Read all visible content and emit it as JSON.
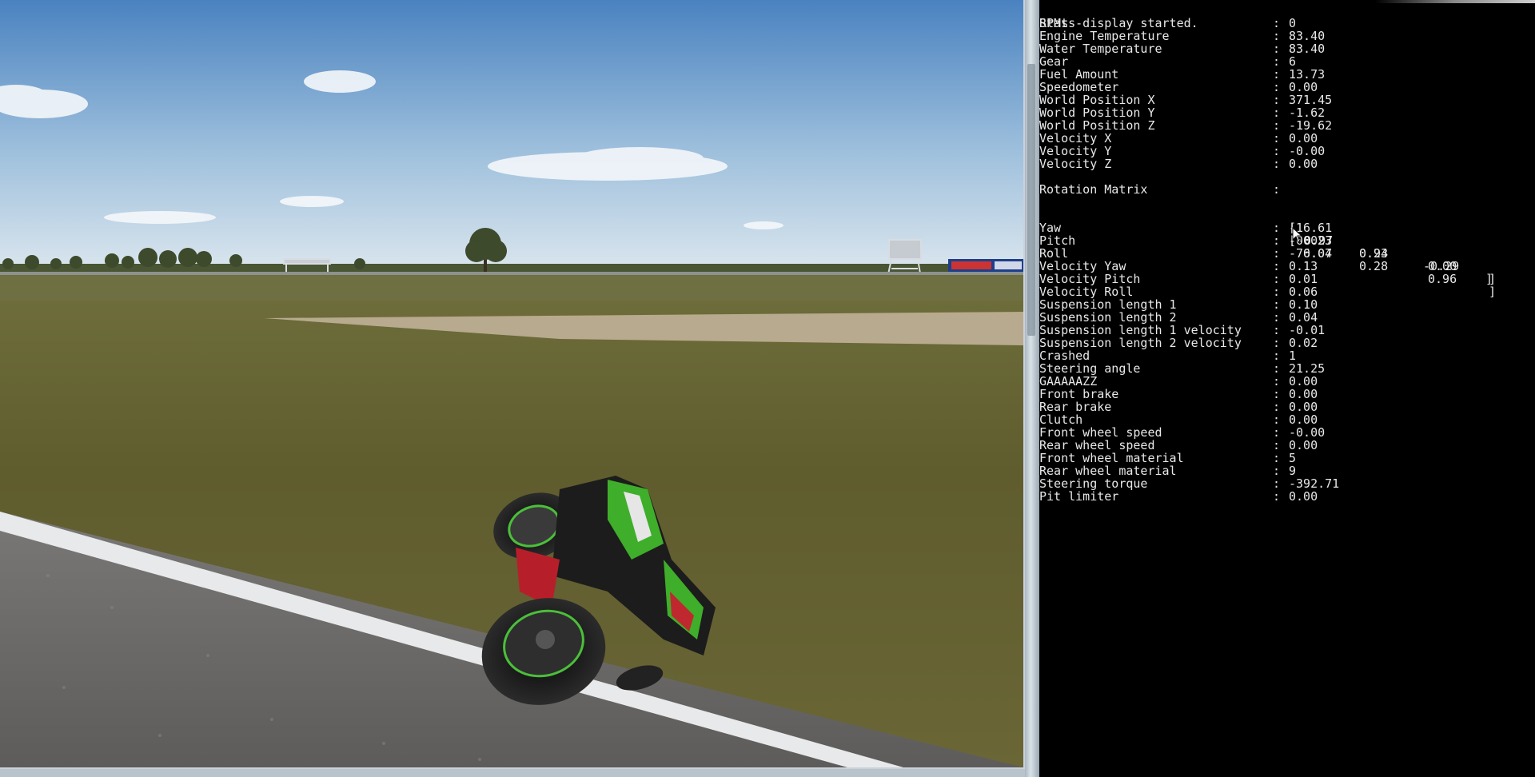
{
  "console": {
    "header": "Stats-display started.",
    "stats_a": [
      {
        "label": "RPMs",
        "value": "0"
      },
      {
        "label": "Engine Temperature",
        "value": "83.40"
      },
      {
        "label": "Water Temperature",
        "value": "83.40"
      },
      {
        "label": "Gear",
        "value": "6"
      },
      {
        "label": "Fuel Amount",
        "value": "13.73"
      },
      {
        "label": "Speedometer",
        "value": "0.00"
      },
      {
        "label": "World Position X",
        "value": "371.45"
      },
      {
        "label": "World Position Y",
        "value": "-1.62"
      },
      {
        "label": "World Position Z",
        "value": "-19.62"
      },
      {
        "label": "Velocity X",
        "value": "0.00"
      },
      {
        "label": "Velocity Y",
        "value": "-0.00"
      },
      {
        "label": "Velocity Z",
        "value": "0.00"
      }
    ],
    "rotation": {
      "label": "Rotation Matrix",
      "rows": [
        [
          "0.23",
          "0.93",
          "-0.29"
        ],
        [
          "-0.97",
          "0.24",
          "0.00"
        ],
        [
          "0.07",
          "0.28",
          "0.96"
        ]
      ]
    },
    "stats_b": [
      {
        "label": "Yaw",
        "value": "-16.61"
      },
      {
        "label": "Pitch",
        "value": "-0.02"
      },
      {
        "label": "Roll",
        "value": "-76.04"
      },
      {
        "label": "Velocity Yaw",
        "value": "0.13"
      },
      {
        "label": "Velocity Pitch",
        "value": "0.01"
      },
      {
        "label": "Velocity Roll",
        "value": "0.06"
      },
      {
        "label": "Suspension length 1",
        "value": "0.10"
      },
      {
        "label": "Suspension length 2",
        "value": "0.04"
      },
      {
        "label": "Suspension length 1 velocity",
        "value": "-0.01"
      },
      {
        "label": "Suspension length 2 velocity",
        "value": "0.02"
      },
      {
        "label": "Crashed",
        "value": "1"
      },
      {
        "label": "Steering angle",
        "value": "21.25"
      },
      {
        "label": "GAAAAAZZ",
        "value": "0.00"
      },
      {
        "label": "Front brake",
        "value": "0.00"
      },
      {
        "label": "Rear brake",
        "value": "0.00"
      },
      {
        "label": "Clutch",
        "value": "0.00"
      },
      {
        "label": "Front wheel speed",
        "value": "-0.00"
      },
      {
        "label": "Rear wheel speed",
        "value": "0.00"
      },
      {
        "label": "Front wheel material",
        "value": "5"
      },
      {
        "label": "Rear wheel material",
        "value": "9"
      },
      {
        "label": "Steering torque",
        "value": "-392.71"
      },
      {
        "label": "Pit limiter",
        "value": "0.00"
      }
    ]
  },
  "scene": {
    "objects": [
      "sky",
      "clouds",
      "tree-line",
      "gantry-sign",
      "billboard",
      "grass",
      "gravel-trap",
      "asphalt",
      "track-line",
      "motorcycle"
    ],
    "colors": {
      "sky_top": "#4d84bf",
      "sky_bottom": "#dbe6ee",
      "grass": "#5d5b2e",
      "gravel": "#b8aa8e",
      "asphalt": "#6e6c6a",
      "bike_accent": "#3fae2a"
    }
  }
}
